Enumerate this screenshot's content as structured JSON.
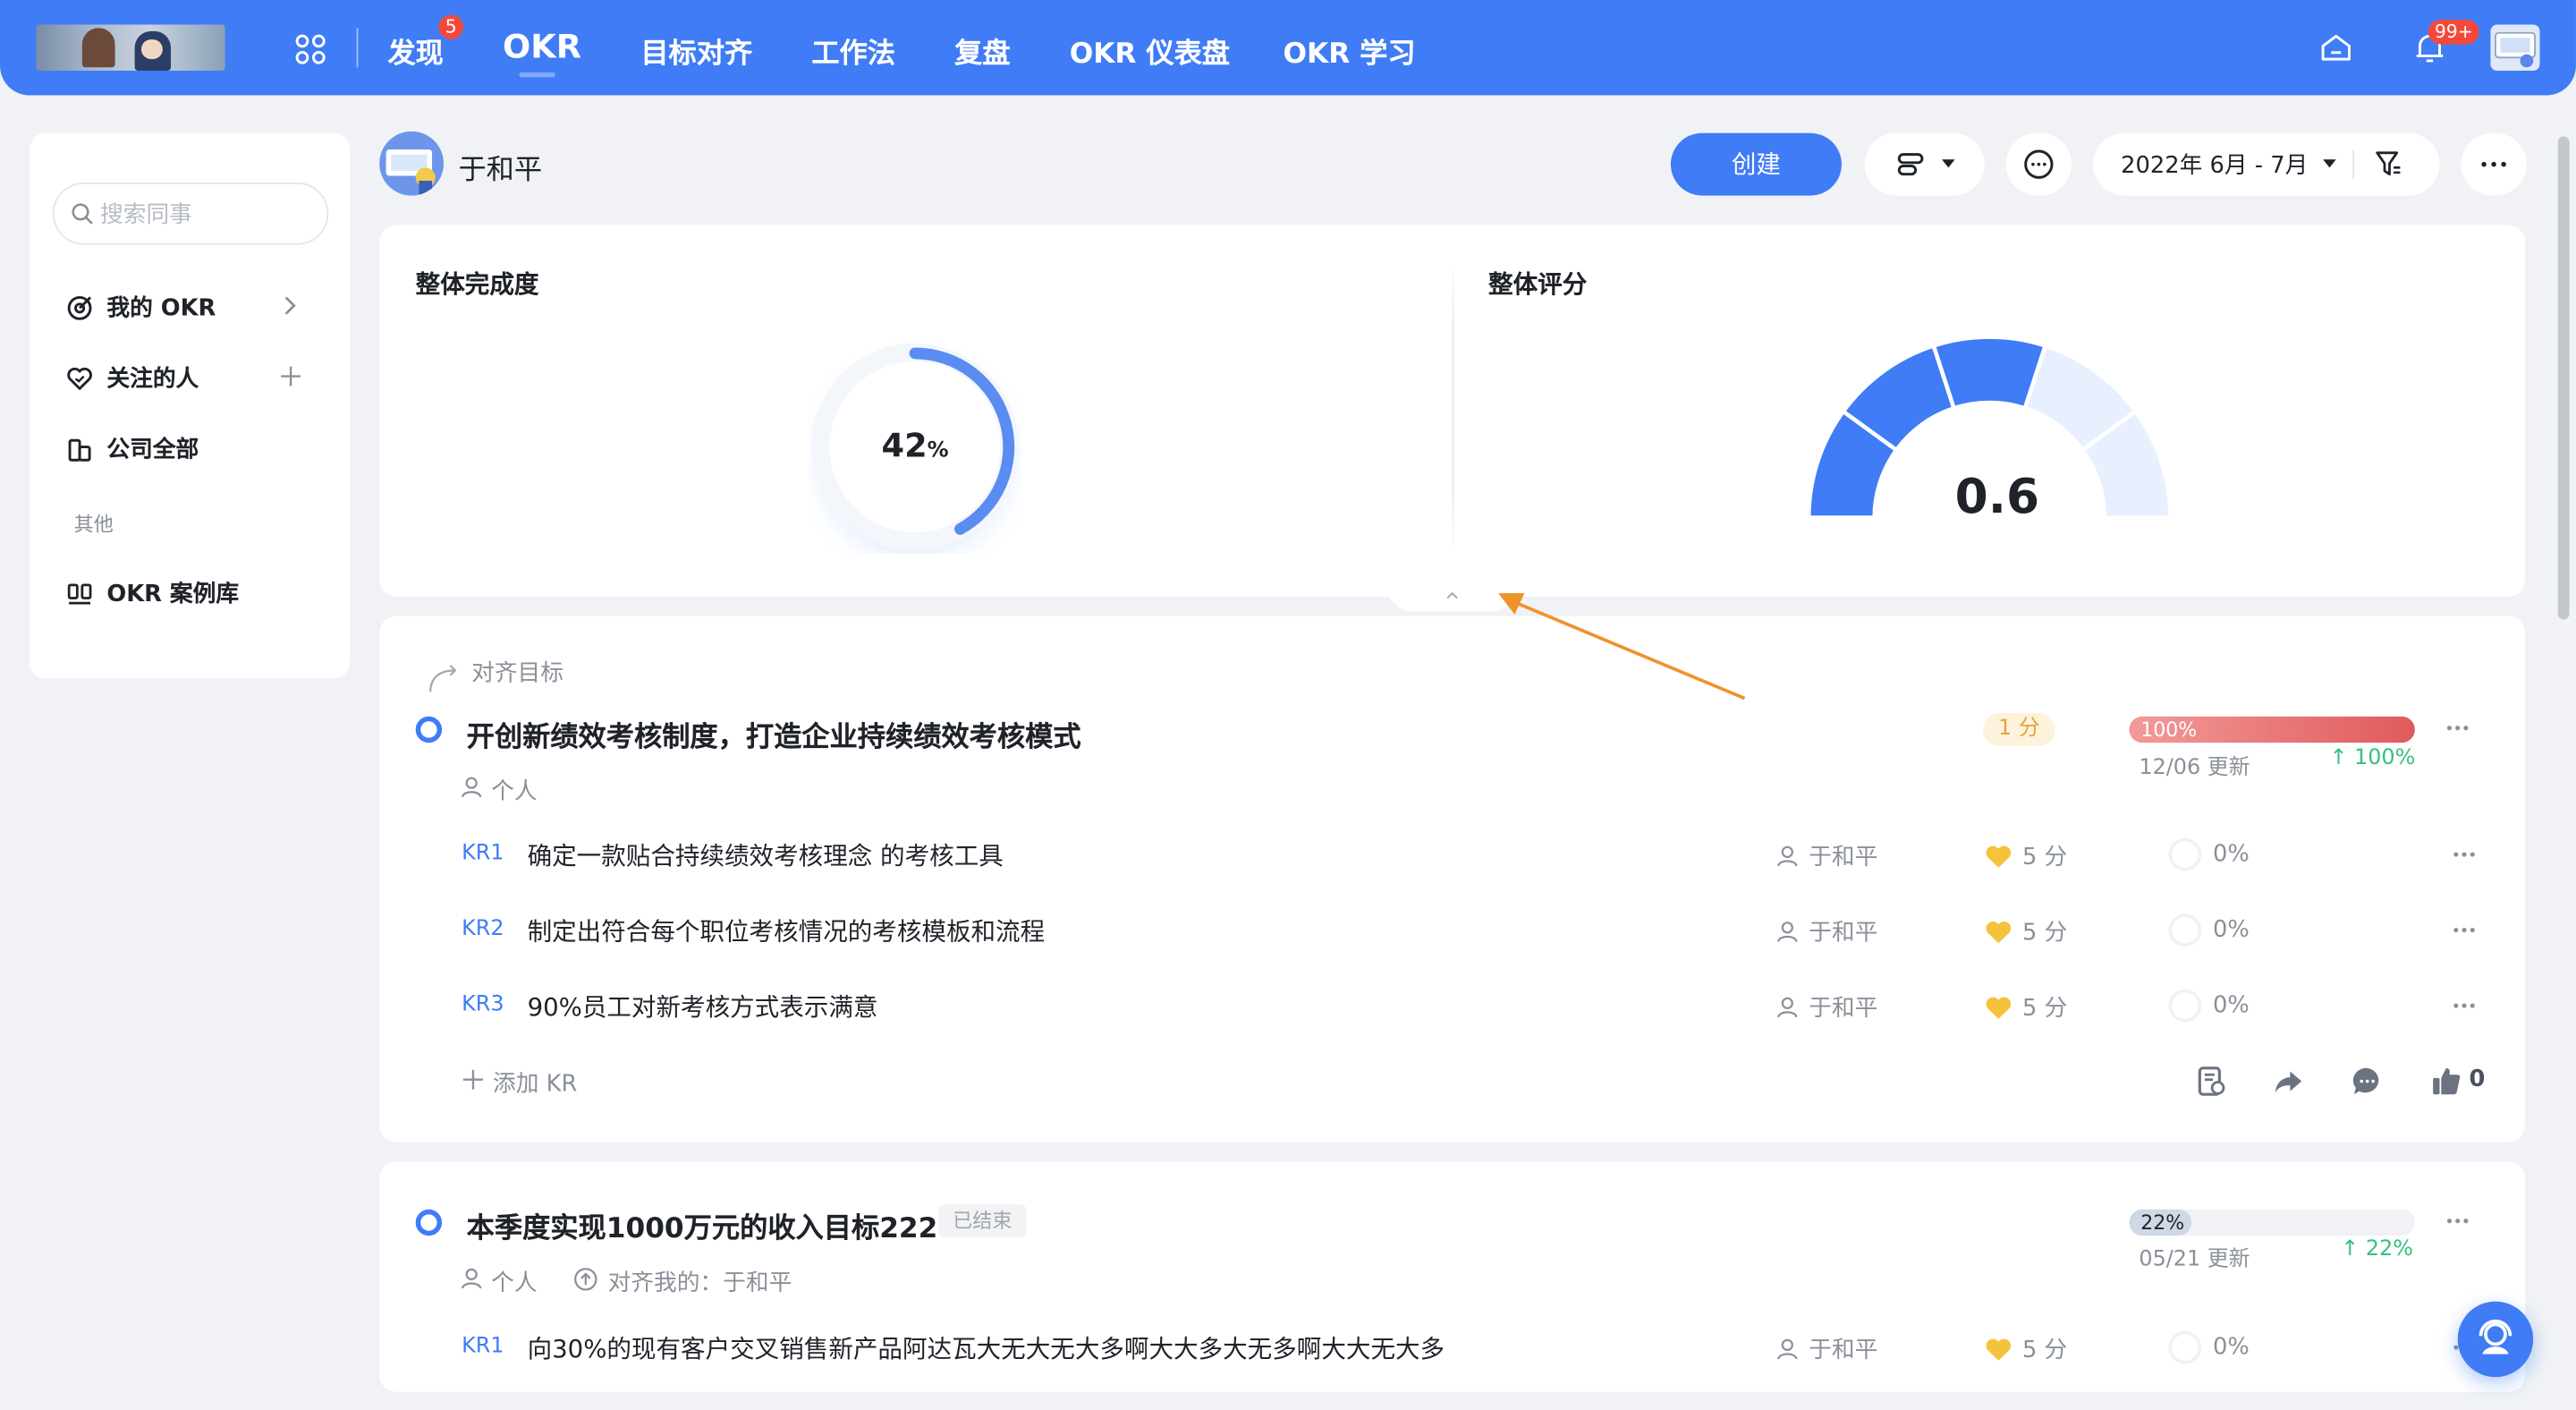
{
  "nav": {
    "discover": "发现",
    "discover_badge": "5",
    "okr": "OKR",
    "align": "目标对齐",
    "method": "工作法",
    "review": "复盘",
    "dashboard": "OKR 仪表盘",
    "learn": "OKR 学习",
    "notify_badge": "99+"
  },
  "sidebar": {
    "search_placeholder": "搜索同事",
    "items": [
      {
        "label": "我的 OKR"
      },
      {
        "label": "关注的人"
      },
      {
        "label": "公司全部"
      }
    ],
    "other_label": "其他",
    "case_library": "OKR 案例库"
  },
  "header": {
    "user_name": "于和平",
    "create_button": "创建",
    "date_range": "2022年 6月 - 7月"
  },
  "summary": {
    "completion_title": "整体完成度",
    "completion_value": "42",
    "completion_unit": "%",
    "completion_fraction": 0.42,
    "score_title": "整体评分",
    "score_value": "0.6",
    "score_fraction": 0.6
  },
  "objectives": [
    {
      "align_label": "对齐目标",
      "title": "开创新绩效考核制度，打造企业持续绩效考核模式",
      "scope": "个人",
      "score": "1 分",
      "progress_label": "100%",
      "progress": 1.0,
      "updated": "12/06 更新",
      "delta": "↑ 100%",
      "krs": [
        {
          "id": "KR1",
          "text": "确定一款贴合持续绩效考核理念 的考核工具",
          "owner": "于和平",
          "score": "5 分",
          "progress": "0%"
        },
        {
          "id": "KR2",
          "text": "制定出符合每个职位考核情况的考核模板和流程",
          "owner": "于和平",
          "score": "5 分",
          "progress": "0%"
        },
        {
          "id": "KR3",
          "text": "90%员工对新考核方式表示满意",
          "owner": "于和平",
          "score": "5 分",
          "progress": "0%"
        }
      ],
      "add_kr": "添加 KR",
      "likes": "0"
    },
    {
      "title": "本季度实现1000万元的收入目标222",
      "status": "已结束",
      "scope": "个人",
      "aligned_to": "对齐我的：于和平",
      "progress_label": "22%",
      "progress": 0.22,
      "updated": "05/21 更新",
      "delta": "↑ 22%",
      "krs": [
        {
          "id": "KR1",
          "text": "向30%的现有客户交叉销售新产品阿达瓦大无大无大多啊大大多大无多啊大大无大多",
          "owner": "于和平",
          "score": "5 分",
          "progress": "0%"
        }
      ]
    }
  ],
  "colors": {
    "primary": "#3f7cf6",
    "gauge_light": "#e8efff",
    "progress_red": "#e05a5a",
    "delta_green": "#36c07e",
    "score_gold": "#f5c23b",
    "annotation_arrow": "#f0922c"
  }
}
